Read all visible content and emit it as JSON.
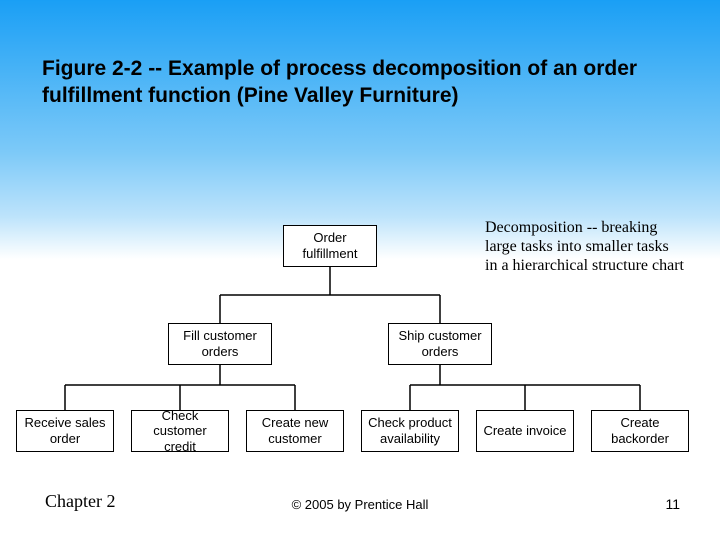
{
  "title": "Figure 2-2 -- Example of process decomposition of an order fulfillment function (Pine Valley Furniture)",
  "annotation": "Decomposition -- breaking large tasks into smaller tasks in a hierarchical structure chart",
  "chart": {
    "root": "Order fulfillment",
    "mid": [
      "Fill customer orders",
      "Ship customer orders"
    ],
    "leaves": [
      "Receive sales order",
      "Check customer credit",
      "Create new customer",
      "Check product availability",
      "Create invoice",
      "Create backorder"
    ]
  },
  "footer": {
    "left": "Chapter 2",
    "center": "© 2005 by Prentice Hall",
    "right": "11"
  }
}
